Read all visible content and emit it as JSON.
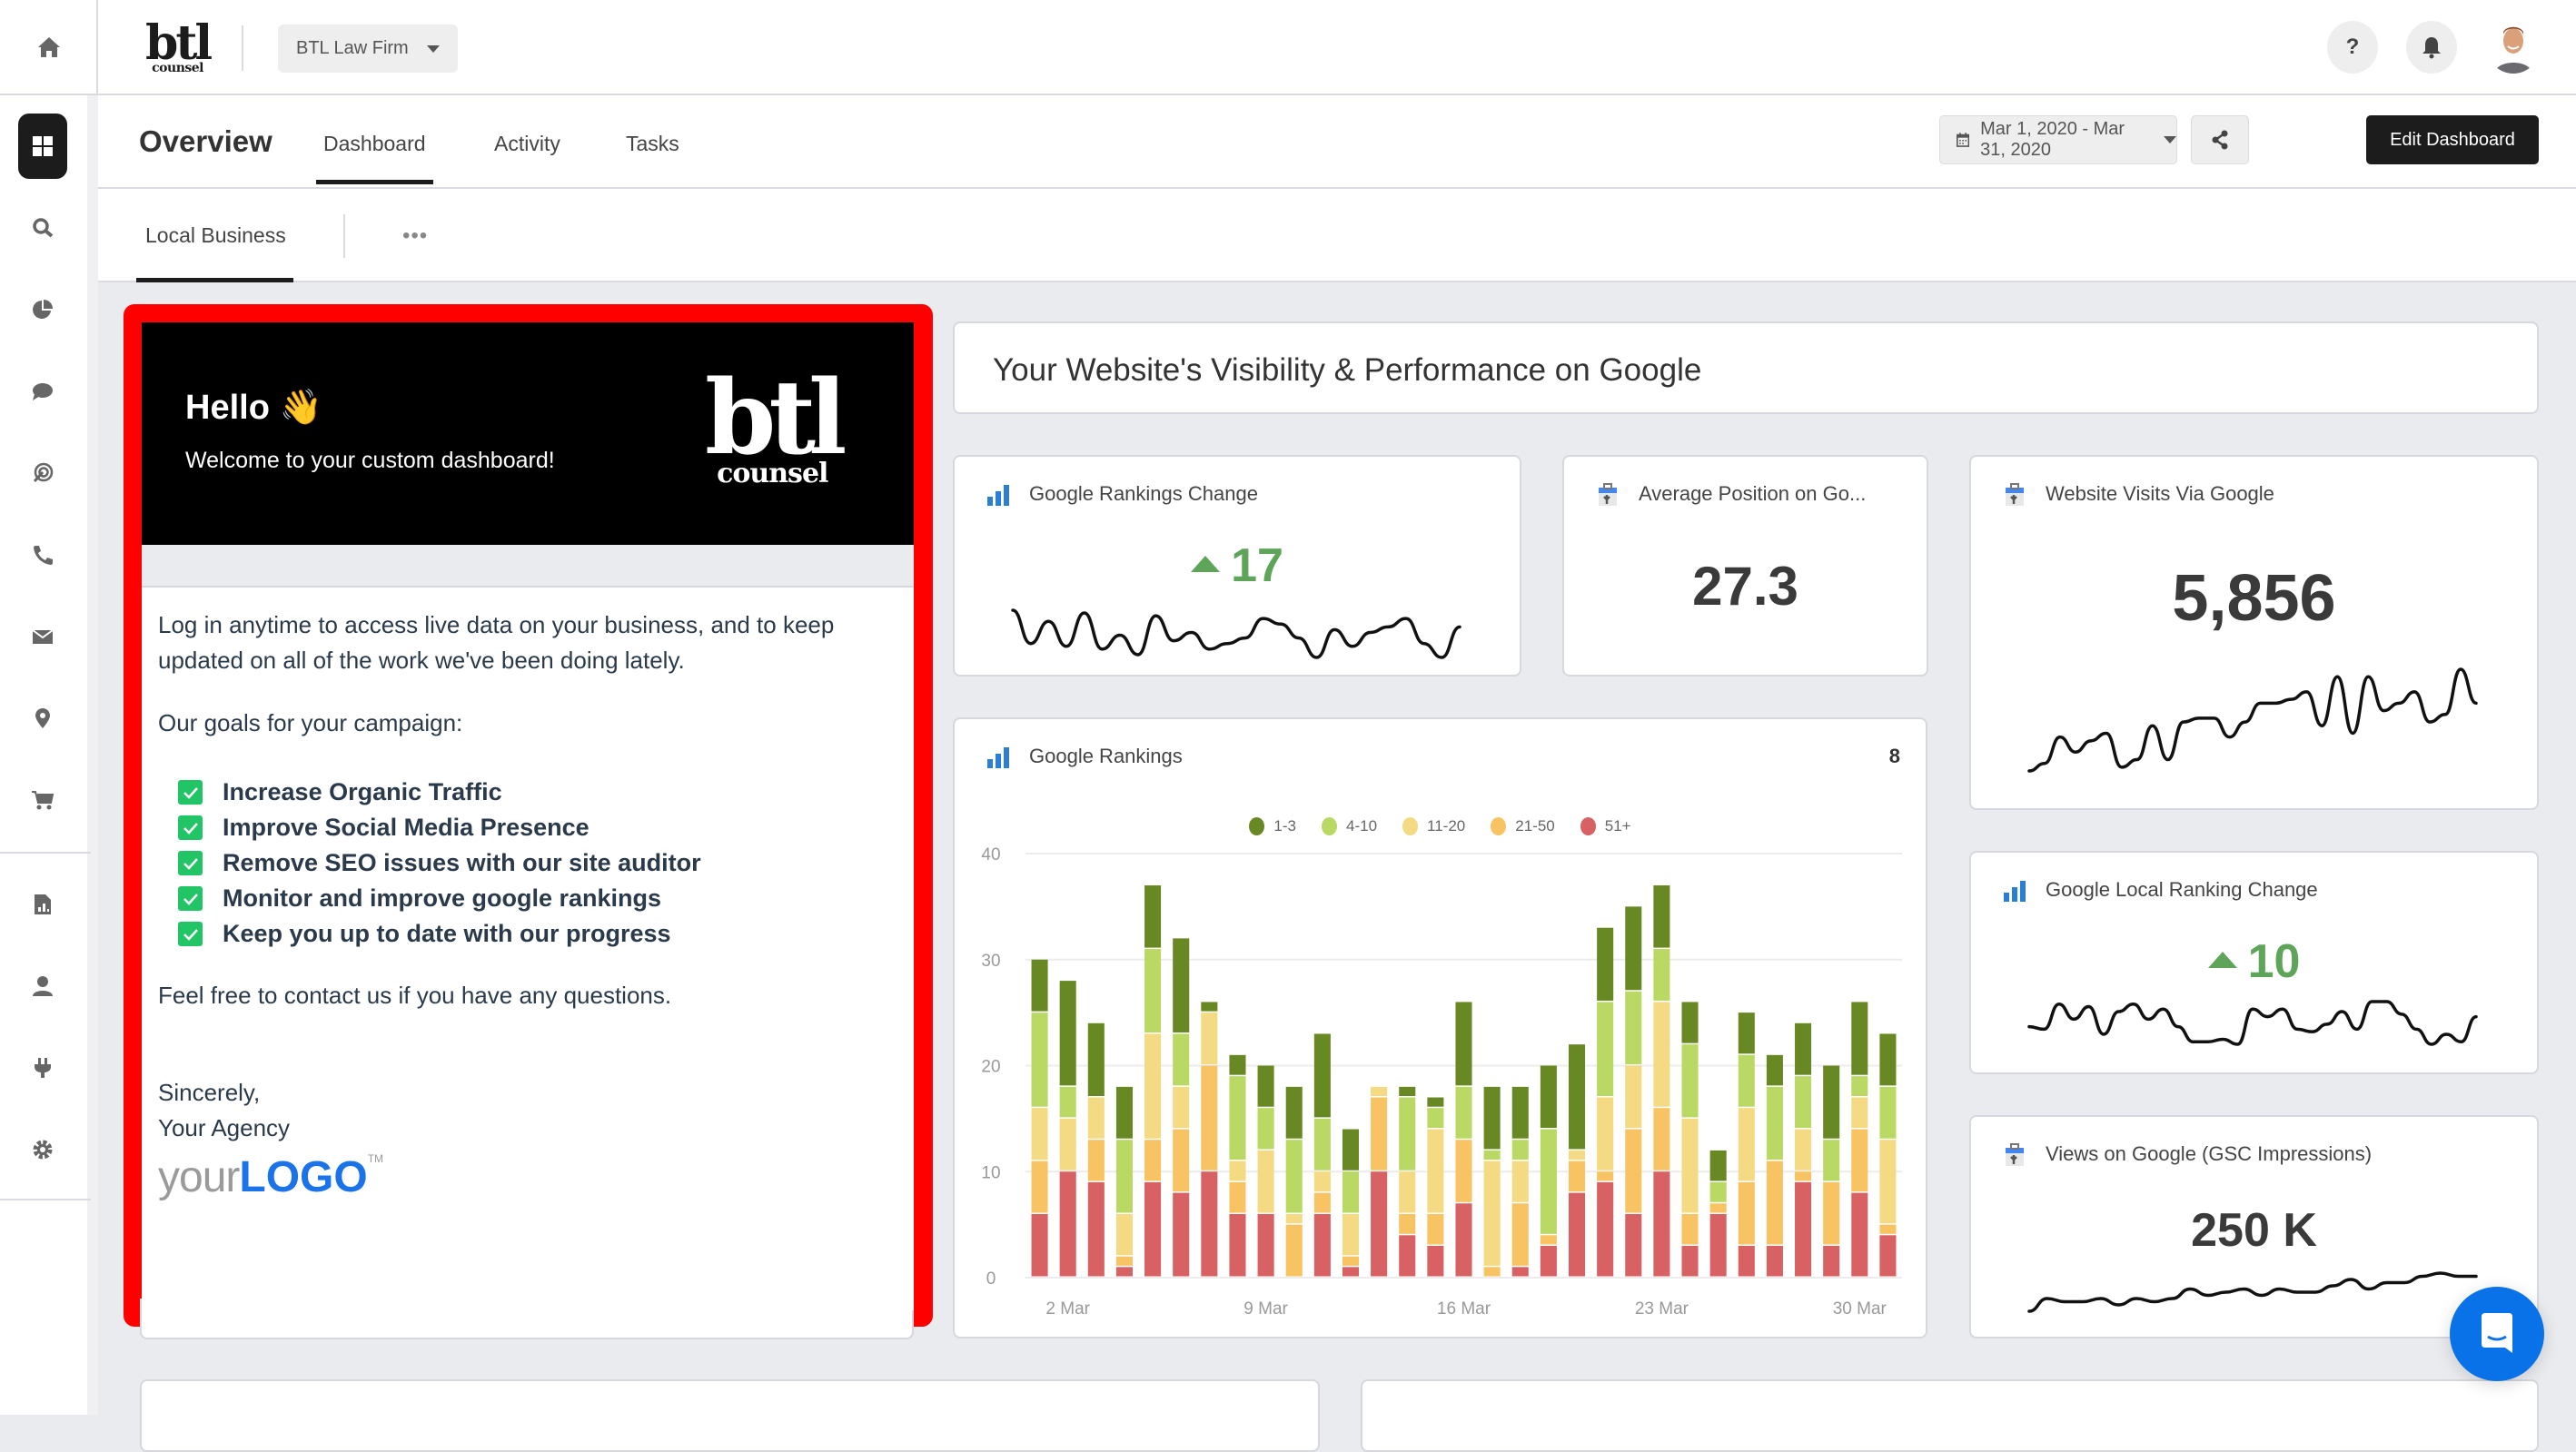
{
  "sidebar": {
    "items": [
      {
        "icon": "home-icon",
        "active": false
      },
      {
        "icon": "dashboard-grid-icon",
        "active": true
      },
      {
        "icon": "search-icon",
        "active": false
      },
      {
        "icon": "pie-chart-icon",
        "active": false
      },
      {
        "icon": "chat-bubble-icon",
        "active": false
      },
      {
        "icon": "target-click-icon",
        "active": false
      },
      {
        "icon": "phone-icon",
        "active": false
      },
      {
        "icon": "envelope-icon",
        "active": false
      },
      {
        "icon": "map-pin-icon",
        "active": false
      },
      {
        "icon": "shopping-cart-icon",
        "active": false
      },
      {
        "icon": "report-icon",
        "active": false
      },
      {
        "icon": "user-icon",
        "active": false
      },
      {
        "icon": "plug-icon",
        "active": false
      },
      {
        "icon": "gear-icon",
        "active": false
      }
    ]
  },
  "topbar": {
    "brand_big": "btl",
    "brand_small": "counsel",
    "client_selector": "BTL Law Firm",
    "help_label": "?"
  },
  "nav": {
    "page_title": "Overview",
    "tabs": [
      {
        "label": "Dashboard",
        "active": true
      },
      {
        "label": "Activity",
        "active": false
      },
      {
        "label": "Tasks",
        "active": false
      }
    ],
    "date_range": "Mar 1, 2020 - Mar 31, 2020",
    "edit_label": "Edit Dashboard"
  },
  "subnav": {
    "tabs": [
      {
        "label": "Local Business",
        "active": true
      }
    ],
    "more_label": "•••"
  },
  "welcome": {
    "hello": "Hello 👋",
    "subtitle": "Welcome to your custom dashboard!",
    "logo_big": "btl",
    "logo_small": "counsel",
    "intro": "Log in anytime to access live data on your business, and to keep updated on all of the work we've been doing lately.",
    "goals_heading": "Our goals for your campaign:",
    "goals": [
      "Increase Organic Traffic",
      "Improve Social Media Presence",
      "Remove SEO issues with our site auditor",
      "Monitor and improve google rankings",
      "Keep you up to date with our progress"
    ],
    "contact": "Feel free to contact us if you have any questions.",
    "signoff": "Sincerely,",
    "agency": "Your Agency",
    "agency_logo_your": "your",
    "agency_logo_logo": "LOGO",
    "agency_logo_tm": "TM"
  },
  "section_header": "Your Website's Visibility & Performance on Google",
  "widgets": {
    "rankings_change": {
      "title": "Google Rankings Change",
      "value": "17",
      "direction": "up",
      "color": "#5ea55a",
      "sparkline": [
        22,
        10,
        18,
        9,
        21,
        8,
        13,
        6,
        20,
        11,
        14,
        8,
        10,
        12,
        19,
        17,
        12,
        5,
        15,
        9,
        14,
        16,
        19,
        10,
        5,
        16
      ]
    },
    "avg_position": {
      "title": "Average Position on Go...",
      "value": "27.3"
    },
    "website_visits": {
      "title": "Website Visits Via Google",
      "value": "5,856",
      "sparkline": [
        2,
        4,
        11,
        7,
        10,
        12,
        3,
        5,
        14,
        5,
        15,
        16,
        16,
        11,
        15,
        20,
        20,
        21,
        23,
        14,
        27,
        12,
        27,
        18,
        20,
        23,
        15,
        17,
        29,
        20
      ]
    },
    "local_ranking_change": {
      "title": "Google Local Ranking Change",
      "value": "10",
      "direction": "up",
      "color": "#5ea55a",
      "sparkline": [
        10,
        9,
        19,
        13,
        18,
        7,
        16,
        19,
        13,
        17,
        10,
        4,
        4,
        5,
        3,
        17,
        14,
        17,
        9,
        8,
        11,
        16,
        9,
        20,
        20,
        15,
        9,
        3,
        7,
        4,
        14
      ]
    },
    "gsc_impressions": {
      "title": "Views on Google (GSC Impressions)",
      "value": "250 K",
      "sparkline": [
        1,
        5,
        4,
        4,
        5,
        3,
        5,
        4,
        5,
        8,
        6,
        7,
        8,
        6,
        8,
        7,
        7,
        9,
        11,
        8,
        10,
        10,
        12,
        13,
        12,
        12
      ]
    }
  },
  "chart_data": {
    "type": "bar",
    "stacked": true,
    "title": "Google Rankings",
    "header_count": "8",
    "xlabel": "",
    "ylabel": "",
    "ylim": [
      0,
      40
    ],
    "yticks": [
      0,
      10,
      20,
      30,
      40
    ],
    "grid": true,
    "legend_position": "top-center",
    "categories": [
      "1 Mar",
      "2 Mar",
      "3 Mar",
      "4 Mar",
      "5 Mar",
      "6 Mar",
      "7 Mar",
      "8 Mar",
      "9 Mar",
      "10 Mar",
      "11 Mar",
      "12 Mar",
      "13 Mar",
      "14 Mar",
      "15 Mar",
      "16 Mar",
      "17 Mar",
      "18 Mar",
      "19 Mar",
      "20 Mar",
      "21 Mar",
      "22 Mar",
      "23 Mar",
      "24 Mar",
      "25 Mar",
      "26 Mar",
      "27 Mar",
      "28 Mar",
      "29 Mar",
      "30 Mar",
      "31 Mar"
    ],
    "xtick_labels": [
      "2 Mar",
      "9 Mar",
      "16 Mar",
      "23 Mar",
      "30 Mar"
    ],
    "series": [
      {
        "name": "51+",
        "color": "#d86163",
        "values": [
          6,
          10,
          9,
          1,
          9,
          8,
          10,
          6,
          6,
          0,
          6,
          1,
          10,
          4,
          3,
          7,
          0,
          1,
          3,
          8,
          9,
          6,
          10,
          3,
          6,
          3,
          3,
          9,
          3,
          8,
          4
        ]
      },
      {
        "name": "21-50",
        "color": "#f8c363",
        "values": [
          5,
          0,
          4,
          1,
          4,
          6,
          10,
          3,
          0,
          5,
          2,
          1,
          7,
          2,
          3,
          6,
          1,
          6,
          1,
          3,
          1,
          8,
          6,
          3,
          1,
          6,
          8,
          1,
          6,
          6,
          1
        ]
      },
      {
        "name": "11-20",
        "color": "#f3da83",
        "values": [
          5,
          5,
          4,
          4,
          10,
          4,
          5,
          2,
          6,
          1,
          2,
          4,
          1,
          4,
          8,
          0,
          10,
          4,
          0,
          1,
          7,
          6,
          10,
          9,
          0,
          7,
          0,
          4,
          0,
          3,
          8
        ]
      },
      {
        "name": "4-10",
        "color": "#b9d864",
        "values": [
          9,
          3,
          0,
          7,
          8,
          5,
          0,
          8,
          4,
          7,
          5,
          4,
          0,
          7,
          2,
          5,
          1,
          2,
          10,
          0,
          9,
          7,
          5,
          7,
          2,
          5,
          7,
          5,
          4,
          2,
          5
        ]
      },
      {
        "name": "1-3",
        "color": "#688824",
        "values": [
          5,
          10,
          7,
          5,
          6,
          9,
          1,
          2,
          4,
          5,
          8,
          4,
          0,
          1,
          1,
          8,
          6,
          5,
          6,
          10,
          7,
          8,
          6,
          4,
          3,
          4,
          3,
          5,
          7,
          7,
          5
        ]
      }
    ],
    "legend_order": [
      "1-3",
      "4-10",
      "11-20",
      "21-50",
      "51+"
    ]
  }
}
